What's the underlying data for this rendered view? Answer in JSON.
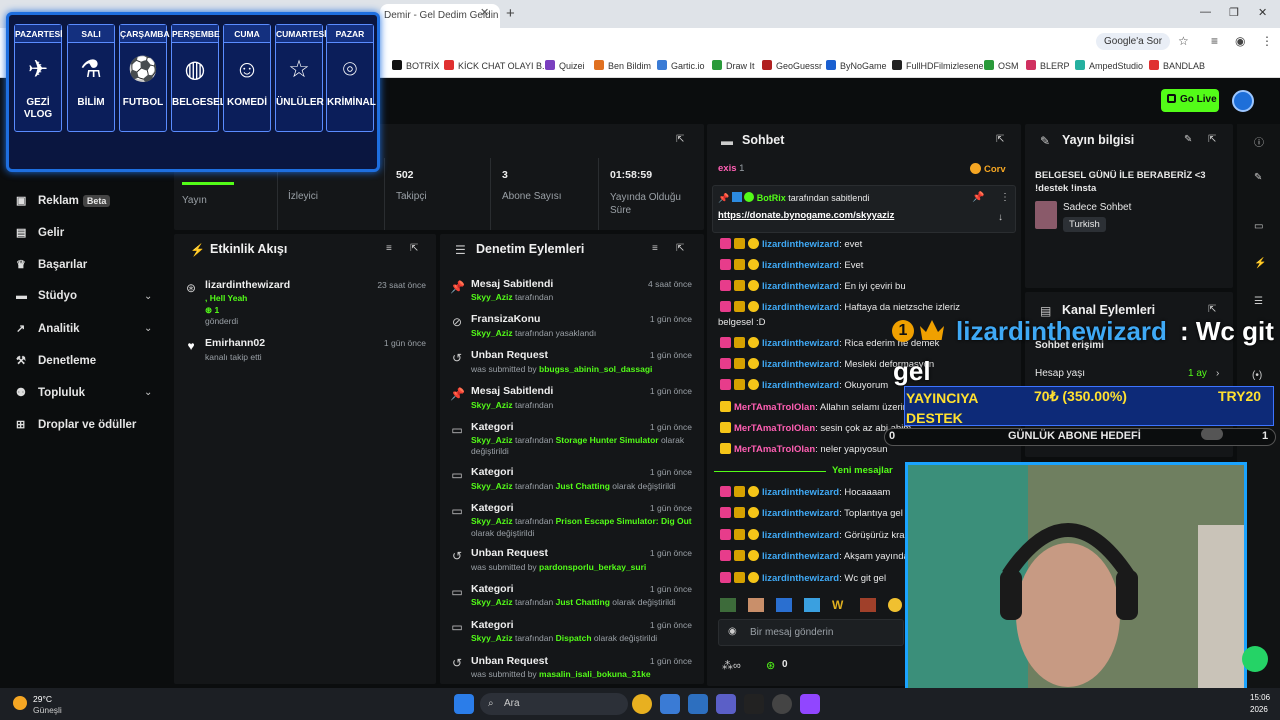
{
  "browser": {
    "tab_title": "Demir - Gel Dedim Geldin",
    "google_button": "Google'a Sor",
    "bookmarks": [
      "BOTRİX",
      "KİCK CHAT OLAYI B...",
      "Quizei",
      "Ben Bildim",
      "Gartic.io",
      "Draw It",
      "GeoGuessr",
      "ByNoGame",
      "FullHDFilmizlesene",
      "OSM",
      "BLERP",
      "AmpedStudio",
      "BANDLAB"
    ]
  },
  "topbar": {
    "go_live": "Go Live"
  },
  "sidebar": {
    "items": [
      {
        "label": "Reklam",
        "badge": "Beta",
        "icon": "ad-icon"
      },
      {
        "label": "Gelir",
        "icon": "chart-icon"
      },
      {
        "label": "Başarılar",
        "icon": "trophy-icon"
      },
      {
        "label": "Stüdyo",
        "icon": "studio-icon"
      },
      {
        "label": "Analitik",
        "icon": "analytics-icon"
      },
      {
        "label": "Denetleme",
        "icon": "hammer-icon"
      },
      {
        "label": "Topluluk",
        "icon": "community-icon"
      },
      {
        "label": "Droplar ve ödüller",
        "icon": "gift-icon"
      }
    ]
  },
  "schedule": {
    "days": [
      {
        "day": "PAZARTESİ",
        "label": "GEZİ VLOG",
        "icon": "globe-plane-icon"
      },
      {
        "day": "SALI",
        "label": "BİLİM",
        "icon": "microscope-icon"
      },
      {
        "day": "ÇARŞAMBA",
        "label": "FUTBOL",
        "icon": "football-icon"
      },
      {
        "day": "PERŞEMBE",
        "label": "BELGESEL",
        "icon": "globe-icon"
      },
      {
        "day": "CUMA",
        "label": "KOMEDİ",
        "icon": "masks-icon"
      },
      {
        "day": "CUMARTESİ",
        "label": "ÜNLÜLER",
        "icon": "star-icon"
      },
      {
        "day": "PAZAR",
        "label": "KRİMİNAL",
        "icon": "fingerprint-icon"
      }
    ]
  },
  "stats": {
    "tabs": [
      {
        "value": "",
        "label": "Yayın"
      },
      {
        "value": "",
        "label": "İzleyici"
      },
      {
        "value": "502",
        "label": "Takipçi"
      },
      {
        "value": "3",
        "label": "Abone Sayısı"
      },
      {
        "value": "01:58:59",
        "label": "Yayında Olduğu Süre"
      }
    ]
  },
  "activity": {
    "title": "Etkinlik Akışı",
    "items": [
      {
        "name": "lizardinthewizard",
        "line1": ", Hell Yeah",
        "line2": "1",
        "line3": "gönderdi",
        "time": "23 saat önce",
        "icon": "kick-coin-icon"
      },
      {
        "name": "Emirhann02",
        "line1": "kanalı takip etti",
        "time": "1 gün önce",
        "icon": "heart-icon"
      }
    ]
  },
  "moderation": {
    "title": "Denetim Eylemleri",
    "items": [
      {
        "title": "Mesaj Sabitlendi",
        "user": "Skyy_Aziz",
        "rest": " tarafından",
        "time": "4 saat önce",
        "icon": "pin-icon"
      },
      {
        "title": "FransizaKonu",
        "user": "Skyy_Aziz",
        "rest": " tarafından yasaklandı",
        "time": "1 gün önce",
        "icon": "ban-icon"
      },
      {
        "title": "Unban Request",
        "pre": "was submitted by ",
        "user": "bbugss_abinin_sol_dassagi",
        "time": "1 gün önce",
        "icon": "history-icon"
      },
      {
        "title": "Mesaj Sabitlendi",
        "user": "Skyy_Aziz",
        "rest": " tarafından",
        "time": "1 gün önce",
        "icon": "pin-icon"
      },
      {
        "title": "Kategori",
        "user": "Skyy_Aziz",
        "rest": " tarafından ",
        "cat": "Storage Hunter Simulator",
        "rest2": " olarak",
        "line3": "değiştirildi",
        "time": "1 gün önce",
        "icon": "category-icon"
      },
      {
        "title": "Kategori",
        "user": "Skyy_Aziz",
        "rest": " tarafından ",
        "cat": "Just Chatting",
        "rest2": " olarak değiştirildi",
        "time": "1 gün önce",
        "icon": "category-icon"
      },
      {
        "title": "Kategori",
        "user": "Skyy_Aziz",
        "rest": " tarafından ",
        "cat": "Prison Escape Simulator: Dig Out",
        "line3": "olarak değiştirildi",
        "time": "1 gün önce",
        "icon": "category-icon"
      },
      {
        "title": "Unban Request",
        "pre": "was submitted by ",
        "user": "pardonsporlu_berkay_suri",
        "time": "1 gün önce",
        "icon": "history-icon"
      },
      {
        "title": "Kategori",
        "user": "Skyy_Aziz",
        "rest": " tarafından ",
        "cat": "Just Chatting",
        "rest2": " olarak değiştirildi",
        "time": "1 gün önce",
        "icon": "category-icon"
      },
      {
        "title": "Kategori",
        "user": "Skyy_Aziz",
        "rest": " tarafından ",
        "cat": "Dispatch",
        "rest2": " olarak değiştirildi",
        "time": "1 gün önce",
        "icon": "category-icon"
      },
      {
        "title": "Unban Request",
        "pre": "was submitted by ",
        "user": "masalin_isali_bokuna_31ke",
        "time": "1 gün önce",
        "icon": "history-icon"
      }
    ]
  },
  "chat": {
    "title": "Sohbet",
    "top_user": "exis",
    "top_count": "1",
    "top_right": "Corv",
    "pinned_by": "BotRix",
    "pinned_suffix": " tarafından sabitlendi",
    "pinned_link": "https://donate.bynogame.com/skyyaziz",
    "messages": [
      {
        "user": "lizardinthewizard",
        "text": ": evet",
        "color": "blue"
      },
      {
        "user": "lizardinthewizard",
        "text": ": Evet",
        "color": "blue"
      },
      {
        "user": "lizardinthewizard",
        "text": ": En iyi çeviri bu",
        "color": "blue"
      },
      {
        "user": "lizardinthewizard",
        "text": ": Haftaya da nietzsche izleriz",
        "text2": "belgesel :D",
        "color": "blue"
      },
      {
        "user": "lizardinthewizard",
        "text": ": Rica ederim ne demek",
        "color": "blue"
      },
      {
        "user": "lizardinthewizard",
        "text": ": Mesleki deformasyon",
        "color": "blue"
      },
      {
        "user": "lizardinthewizard",
        "text": ": Okuyorum",
        "color": "blue"
      },
      {
        "user": "MerTAmaTrolOlan",
        "text": ": Allahın selamı üzerinize olsun",
        "color": "pink"
      },
      {
        "user": "MerTAmaTrolOlan",
        "text": ": sesin çok az abi abim",
        "color": "pink"
      },
      {
        "user": "MerTAmaTrolOlan",
        "text": ": neler yapıyosun",
        "color": "pink"
      }
    ],
    "new_messages_label": "Yeni mesajlar",
    "messages_new": [
      {
        "user": "lizardinthewizard",
        "text": ": Hocaaaam"
      },
      {
        "user": "lizardinthewizard",
        "text": ": Toplantıya gel"
      },
      {
        "user": "lizardinthewizard",
        "text": ": Görüşürüz kral"
      },
      {
        "user": "lizardinthewizard",
        "text": ": Akşam yayında"
      },
      {
        "user": "lizardinthewizard",
        "text": ": Wc git gel"
      }
    ],
    "input_placeholder": "Bir mesaj gönderin",
    "footer_count": "0"
  },
  "stream_info": {
    "title": "Yayın bilgisi",
    "stream_title": "BELGESEL GÜNÜ İLE BERABERİZ <3 !destek !insta",
    "mode": "Sadece Sohbet",
    "language": "Turkish"
  },
  "channel_actions": {
    "title": "Kanal Eylemleri",
    "subtitle": "Sohbet erişimi",
    "row_label": "Hesap yaşı",
    "row_value": "1 ay"
  },
  "overlay": {
    "alert_rank": "1",
    "alert_user": "lizardinthewizard",
    "alert_msg": ": Wc git",
    "alert_msg2": "gel",
    "donation_label": "YAYINCIYA DESTEK",
    "donation_amount": "70₺ (350.00%)",
    "donation_target": "TRY20",
    "goal_label": "GÜNLÜK ABONE HEDEFİ",
    "goal_left": "0",
    "goal_right": "1"
  },
  "taskbar": {
    "weather_temp": "29°C",
    "weather_text": "Güneşli",
    "search": "Ara",
    "time": "15:06",
    "date": "2026"
  }
}
